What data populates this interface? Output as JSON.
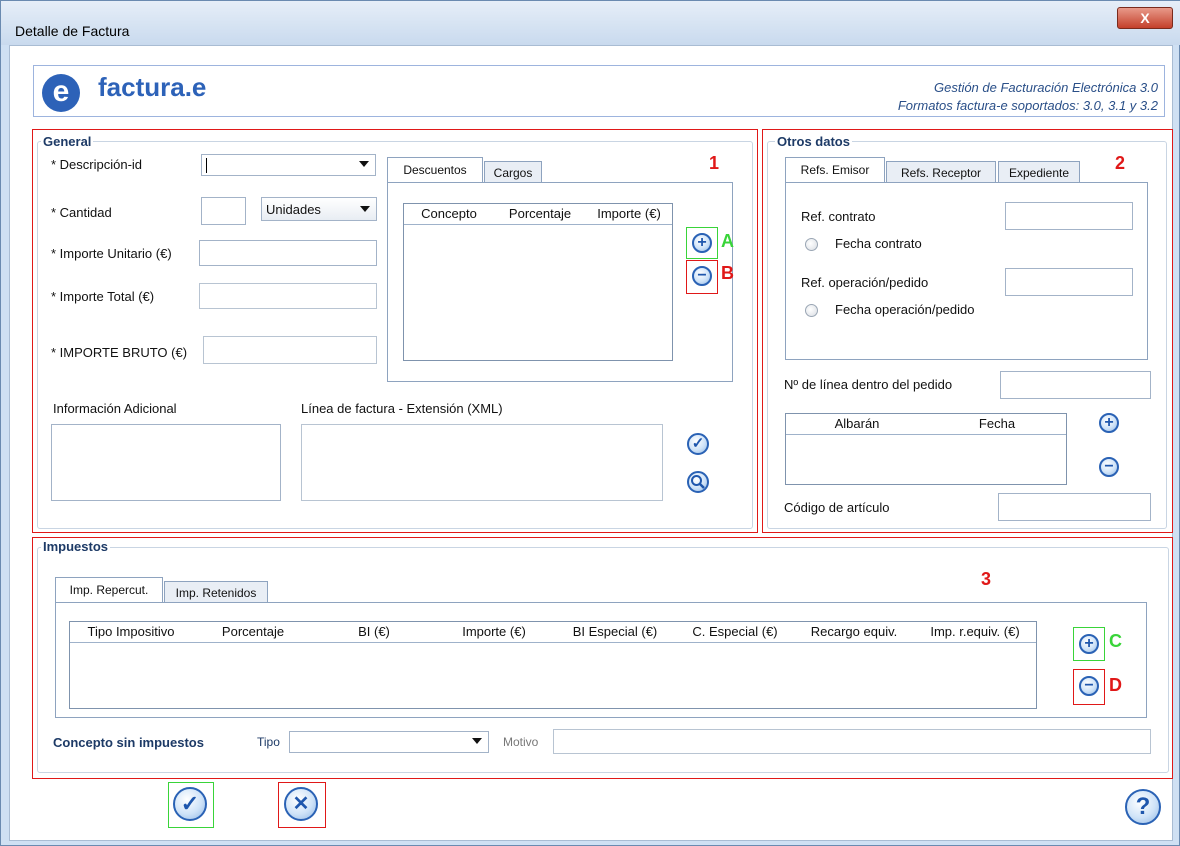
{
  "window": {
    "title": "Detalle de Factura",
    "close_label": "X"
  },
  "header": {
    "logo_text": "factura.e",
    "line1": "Gestión de Facturación Electrónica 3.0",
    "line2": "Formatos factura-e soportados: 3.0, 3.1 y 3.2"
  },
  "general": {
    "title": "General",
    "annotation": "1",
    "descripcion_label": "* Descripción-id",
    "cantidad_label": "* Cantidad",
    "unidades_value": "Unidades",
    "importe_unitario_label": "* Importe Unitario (€)",
    "importe_total_label": "* Importe Total (€)",
    "importe_bruto_label": "* IMPORTE BRUTO (€)",
    "tabs": [
      "Descuentos",
      "Cargos"
    ],
    "grid_headers": [
      "Concepto",
      "Porcentaje",
      "Importe (€)"
    ],
    "add_label": "A",
    "remove_label": "B",
    "info_adicional_label": "Información Adicional",
    "linea_factura_label": "Línea de factura - Extensión (XML)"
  },
  "otros": {
    "title": "Otros datos",
    "annotation": "2",
    "tabs": [
      "Refs. Emisor",
      "Refs. Receptor",
      "Expediente"
    ],
    "ref_contrato_label": "Ref. contrato",
    "fecha_contrato_label": "Fecha contrato",
    "ref_operacion_label": "Ref. operación/pedido",
    "fecha_operacion_label": "Fecha operación/pedido",
    "num_linea_label": "Nº de línea dentro del pedido",
    "albaran_headers": [
      "Albarán",
      "Fecha"
    ],
    "codigo_articulo_label": "Código de artículo"
  },
  "impuestos": {
    "title": "Impuestos",
    "annotation": "3",
    "tabs": [
      "Imp. Repercut.",
      "Imp. Retenidos"
    ],
    "grid_headers": [
      "Tipo Impositivo",
      "Porcentaje",
      "BI (€)",
      "Importe (€)",
      "BI Especial (€)",
      "C. Especial (€)",
      "Recargo equiv.",
      "Imp. r.equiv. (€)"
    ],
    "add_label": "C",
    "remove_label": "D",
    "concepto_sin_label": "Concepto sin impuestos",
    "tipo_label": "Tipo",
    "motivo_label": "Motivo"
  },
  "icons": {
    "plus": "+",
    "minus": "−",
    "check": "✓",
    "cancel": "✕",
    "help": "?",
    "search": "search-icon"
  },
  "colors": {
    "annotation_red": "#e01818",
    "annotation_green": "#39d439",
    "accent_blue": "#2a62b5"
  }
}
